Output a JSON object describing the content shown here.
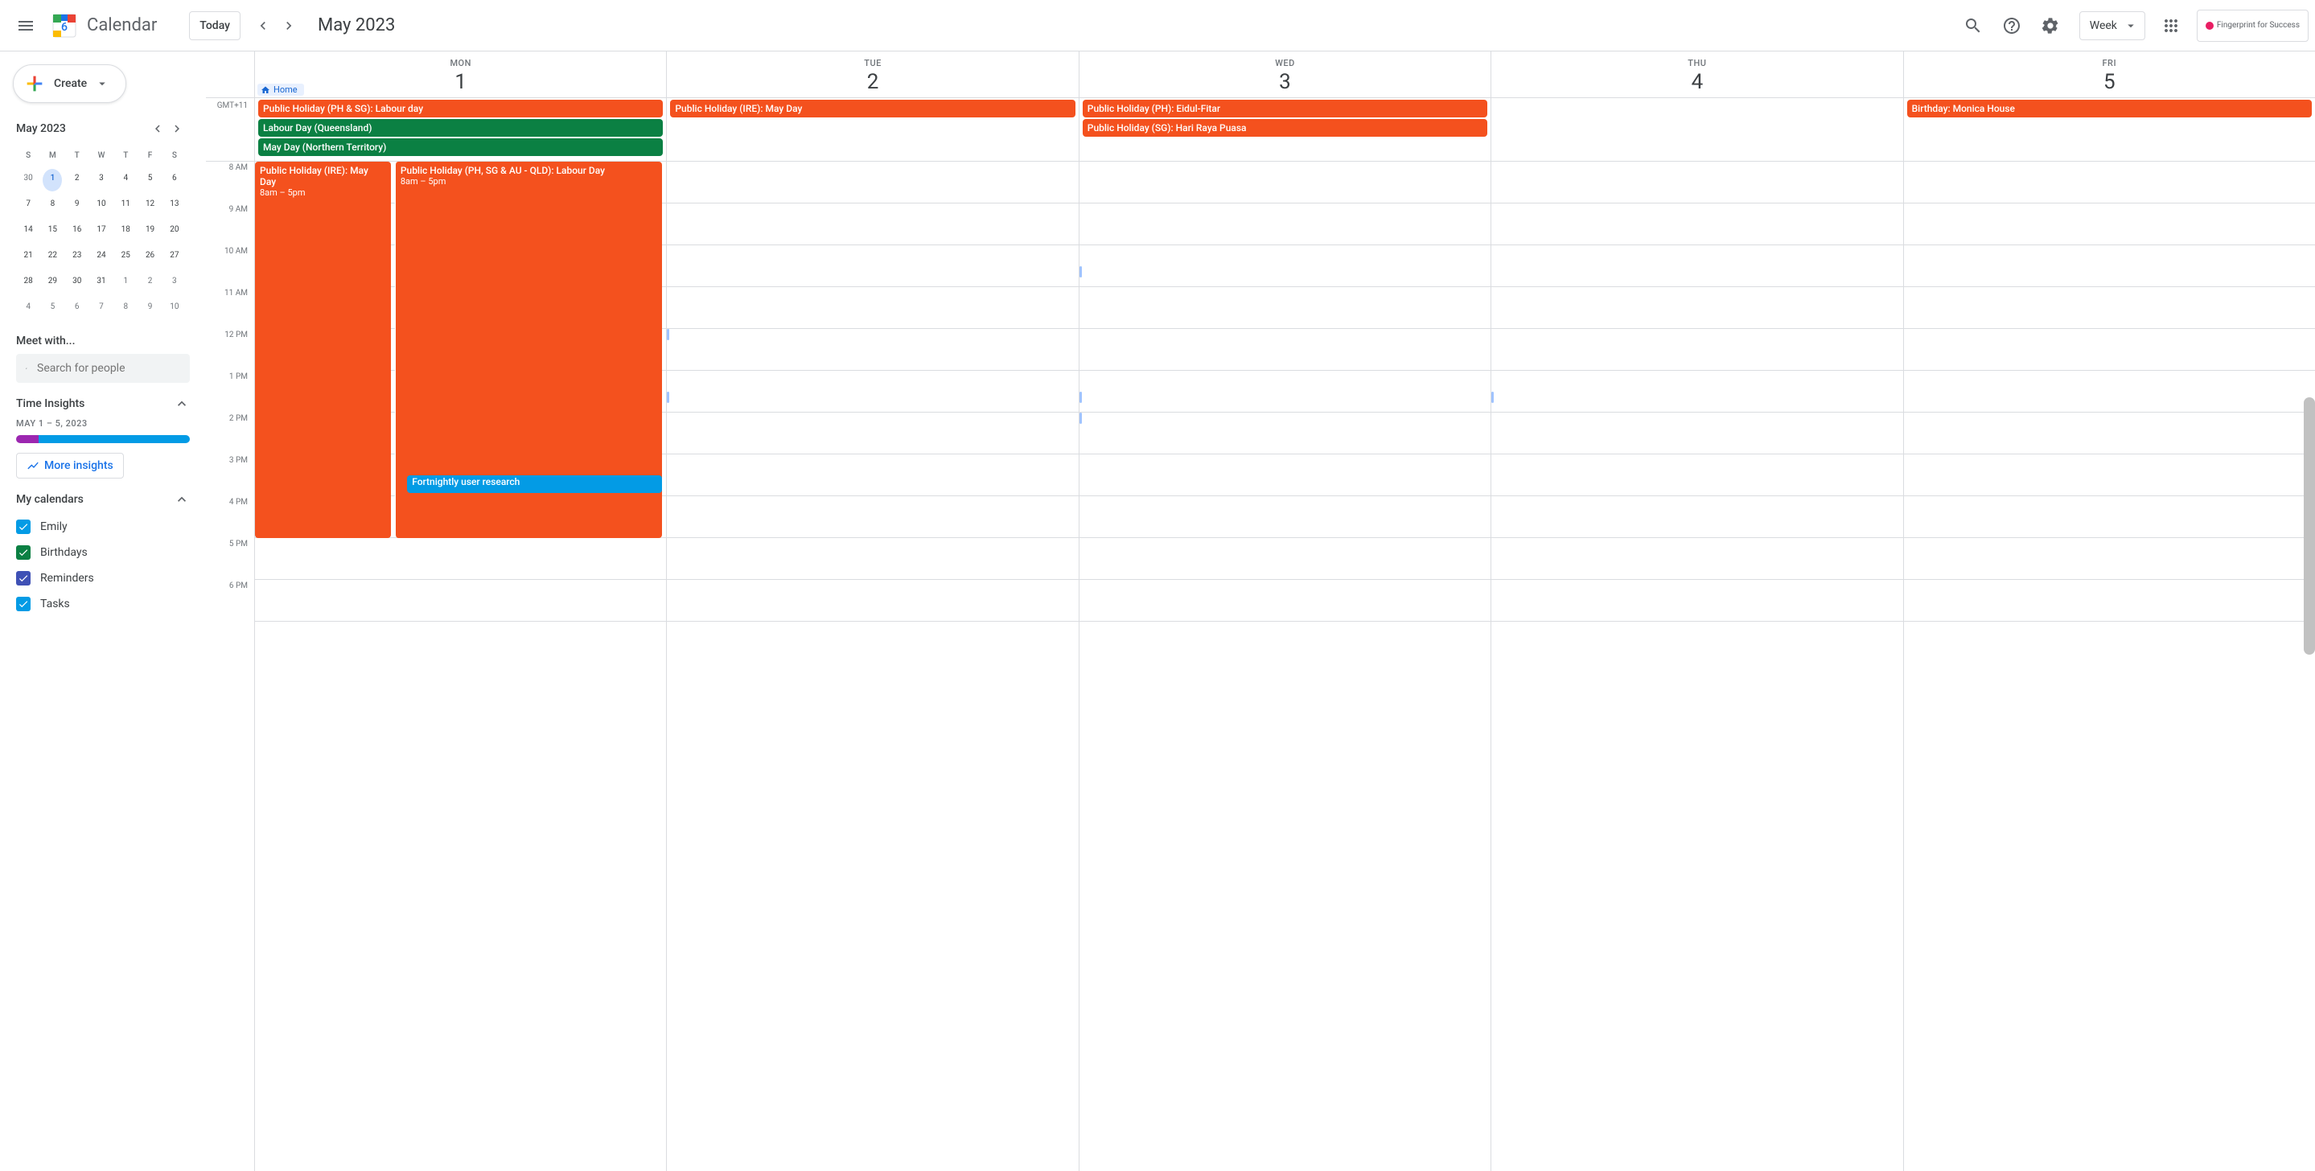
{
  "header": {
    "app_name": "Calendar",
    "today_label": "Today",
    "month_title": "May 2023",
    "view_label": "Week",
    "ext_label": "Fingerprint for Success"
  },
  "sidebar": {
    "create_label": "Create",
    "mini_cal_title": "May 2023",
    "dow": [
      "S",
      "M",
      "T",
      "W",
      "T",
      "F",
      "S"
    ],
    "mini_days": [
      {
        "n": "30",
        "other": true
      },
      {
        "n": "1",
        "today": true
      },
      {
        "n": "2"
      },
      {
        "n": "3"
      },
      {
        "n": "4"
      },
      {
        "n": "5"
      },
      {
        "n": "6"
      },
      {
        "n": "7"
      },
      {
        "n": "8"
      },
      {
        "n": "9"
      },
      {
        "n": "10"
      },
      {
        "n": "11"
      },
      {
        "n": "12"
      },
      {
        "n": "13"
      },
      {
        "n": "14"
      },
      {
        "n": "15"
      },
      {
        "n": "16"
      },
      {
        "n": "17"
      },
      {
        "n": "18"
      },
      {
        "n": "19"
      },
      {
        "n": "20"
      },
      {
        "n": "21"
      },
      {
        "n": "22"
      },
      {
        "n": "23"
      },
      {
        "n": "24"
      },
      {
        "n": "25"
      },
      {
        "n": "26"
      },
      {
        "n": "27"
      },
      {
        "n": "28"
      },
      {
        "n": "29"
      },
      {
        "n": "30"
      },
      {
        "n": "31"
      },
      {
        "n": "1",
        "other": true
      },
      {
        "n": "2",
        "other": true
      },
      {
        "n": "3",
        "other": true
      },
      {
        "n": "4",
        "other": true
      },
      {
        "n": "5",
        "other": true
      },
      {
        "n": "6",
        "other": true
      },
      {
        "n": "7",
        "other": true
      },
      {
        "n": "8",
        "other": true
      },
      {
        "n": "9",
        "other": true
      },
      {
        "n": "10",
        "other": true
      }
    ],
    "meet_with_label": "Meet with...",
    "search_placeholder": "Search for people",
    "time_insights_label": "Time Insights",
    "insights_range": "MAY 1 – 5, 2023",
    "more_insights_label": "More insights",
    "my_calendars_label": "My calendars",
    "calendars": [
      {
        "label": "Emily",
        "color": "#039be5"
      },
      {
        "label": "Birthdays",
        "color": "#0b8043"
      },
      {
        "label": "Reminders",
        "color": "#3f51b5"
      },
      {
        "label": "Tasks",
        "color": "#039be5"
      }
    ]
  },
  "grid": {
    "tz": "GMT+11",
    "home_label": "Home",
    "days": [
      {
        "dow": "MON",
        "num": "1"
      },
      {
        "dow": "TUE",
        "num": "2"
      },
      {
        "dow": "WED",
        "num": "3"
      },
      {
        "dow": "THU",
        "num": "4"
      },
      {
        "dow": "FRI",
        "num": "5"
      }
    ],
    "hours": [
      "8 AM",
      "9 AM",
      "10 AM",
      "11 AM",
      "12 PM",
      "1 PM",
      "2 PM",
      "3 PM",
      "4 PM",
      "5 PM",
      "6 PM"
    ],
    "allday": {
      "mon": [
        {
          "t": "Public Holiday (PH & SG): Labour day",
          "c": "orange"
        },
        {
          "t": "Labour Day (Queensland)",
          "c": "green"
        },
        {
          "t": "May Day (Northern Territory)",
          "c": "green"
        }
      ],
      "tue": [
        {
          "t": "Public Holiday (IRE): May Day",
          "c": "orange"
        }
      ],
      "wed": [
        {
          "t": "Public Holiday (PH): Eidul-Fitar",
          "c": "orange"
        },
        {
          "t": "Public Holiday (SG): Hari Raya Puasa",
          "c": "orange"
        }
      ],
      "fri": [
        {
          "t": "Birthday: Monica House",
          "c": "orange"
        }
      ]
    },
    "mon_ev1_title": "Public Holiday (IRE): May Day",
    "mon_ev1_time": "8am – 5pm",
    "mon_ev2_title": "Public Holiday (PH, SG & AU - QLD): Labour Day",
    "mon_ev2_time": "8am – 5pm",
    "mon_ev3_title": "Fortnightly user research"
  }
}
